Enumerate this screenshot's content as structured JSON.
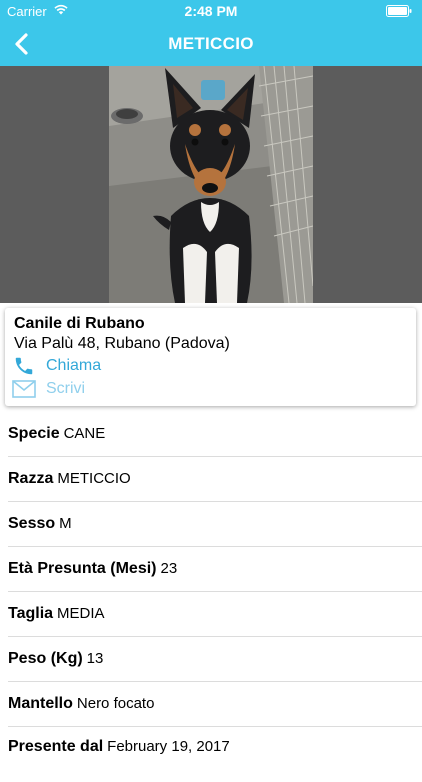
{
  "status_bar": {
    "carrier": "Carrier",
    "time": "2:48 PM"
  },
  "nav": {
    "title": "METICCIO"
  },
  "shelter": {
    "name": "Canile di Rubano",
    "address": "Via Palù 48, Rubano (Padova)",
    "call_label": "Chiama",
    "write_label": "Scrivi"
  },
  "details": [
    {
      "label": "Specie",
      "value": "CANE"
    },
    {
      "label": "Razza",
      "value": "METICCIO"
    },
    {
      "label": "Sesso",
      "value": "M"
    },
    {
      "label": "Età Presunta (Mesi)",
      "value": "23"
    },
    {
      "label": "Taglia",
      "value": "MEDIA"
    },
    {
      "label": "Peso (Kg)",
      "value": "13"
    },
    {
      "label": "Mantello",
      "value": "Nero focato"
    },
    {
      "label": "Presente dal",
      "value": "February 19, 2017"
    }
  ],
  "colors": {
    "nav_bg": "#3cc7ea",
    "link": "#33a8d8",
    "link_muted": "#8fcfec"
  }
}
